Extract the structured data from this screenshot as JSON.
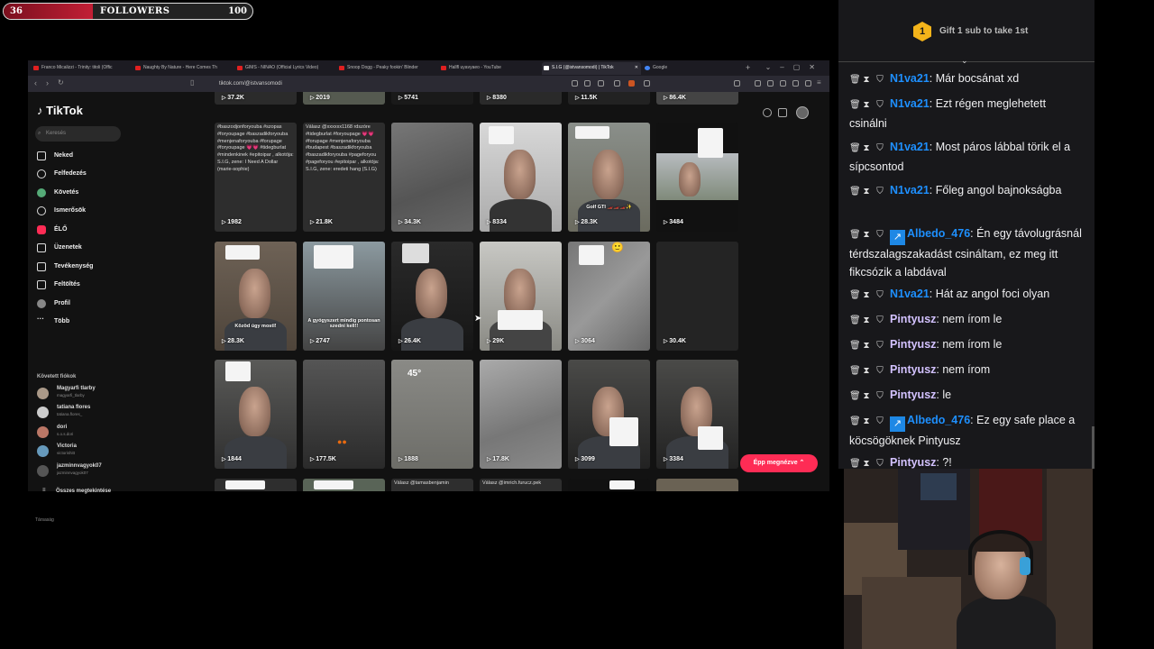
{
  "followers": {
    "current": "36",
    "label": "FOLLOWERS",
    "goal": "100",
    "progress_fraction": 0.36
  },
  "browser": {
    "tabs": [
      {
        "title": "Franco Micalizzi - Trinity: titoli (Offic"
      },
      {
        "title": "Naughty By Nature - Here Comes Th"
      },
      {
        "title": "GIMS - NINAO (Official Lyrics Video)"
      },
      {
        "title": "Snoop Dogg - Peaky fookin' Blinder"
      },
      {
        "title": "Hallfl uyavyaeo - YouTube"
      },
      {
        "title": "S.I.G (@istvansomodi) | TikTok"
      },
      {
        "title": "Google"
      }
    ],
    "url": "tiktok.com/@istvansomodi"
  },
  "tiktok": {
    "logo": "TikTok",
    "search_placeholder": "Keresés",
    "nav": [
      "Neked",
      "Felfedezés",
      "Követés",
      "Ismerősök",
      "ÉLŐ",
      "Üzenetek",
      "Tevékenység",
      "Feltöltés",
      "Profil",
      "Több"
    ],
    "followed_title": "Követett fiókok",
    "followed": [
      {
        "name": "Magyarfi tlarby",
        "handle": "magyarfi_tlarby"
      },
      {
        "name": "tatiana flores",
        "handle": "tatiana.flores_"
      },
      {
        "name": "dori",
        "handle": "s.o.s.dori"
      },
      {
        "name": "Victoria",
        "handle": "victorishitt"
      },
      {
        "name": "jazminnvagyok07",
        "handle": "jazminnvagyok07"
      }
    ],
    "see_all": "Összes megtekintése",
    "company": "Társaság",
    "top_row_counts": [
      "37.2K",
      "2019",
      "5741",
      "8380",
      "11.5K",
      "86.4K"
    ],
    "row1": {
      "caption1": "#baszodjonforyouba #szopas #foryoupage #baszadikforyouba #menjenaforyouba #forupage #foryoupage 💗💗 #tidegburlat #mindenkinek #epitoipar , alkotója: S.I.G, zene: I Need A Dollar (marie-sophie)",
      "caption2": "Válasz @xxxxxx1168 rdszóre #tidegburlat #foryoupage 💗💗 #forupage #menjenaforyouba #budapest #baszadikforyouba #baszadikforyouba #pageforyou #pageforyou #epitoipar , alkotója: S.I.G, zene: eredeti hang (S.I.G)",
      "counts": [
        "1982",
        "21.8K",
        "34.3K",
        "8334",
        "28.3K",
        "3484"
      ],
      "sub5": "Golf GTI 🏎️🏎️🏎️✨"
    },
    "row2": {
      "counts": [
        "28.3K",
        "2747",
        "26.4K",
        "29K",
        "3064",
        "30.4K"
      ],
      "sub1": "Közöd úgy mostl!",
      "sub2": "A gyógyszert mindig pontosan szedni kell!!"
    },
    "row3": {
      "counts": [
        "1844",
        "177.5K",
        "1888",
        "17.8K",
        "3099",
        "3384"
      ],
      "sub3": "45°"
    },
    "bottom_row_captions": [
      "Válasz @tamasbenjamin",
      "Válasz @imrich.furucz.pek"
    ],
    "watching_button": "Épp megnézve ⌃"
  },
  "chat": {
    "gift_badge": "1",
    "gift_text": "Gift 1 sub to take 1st",
    "messages": [
      {
        "user": "N1va21",
        "text": "Már bocsánat xd",
        "color": "#1e90ff"
      },
      {
        "user": "N1va21",
        "text": "Ezt régen meglehetett csinálni",
        "color": "#1e90ff"
      },
      {
        "user": "N1va21",
        "text": "Most páros lábbal törik el a sípcsontod",
        "color": "#1e90ff"
      },
      {
        "user": "N1va21",
        "text": "Főleg angol bajnokságba",
        "color": "#1e90ff"
      },
      {
        "user": "Albedo_476",
        "text": "Én egy távolugrásnál térdszalagszakadást csináltam, ez meg itt fikcsózik a labdával",
        "color": "#1e90ff",
        "vip": true
      },
      {
        "user": "N1va21",
        "text": "Hát az angol foci olyan",
        "color": "#1e90ff"
      },
      {
        "user": "Pintyusz",
        "text": "nem írom le",
        "color": "#d3c2ff"
      },
      {
        "user": "Pintyusz",
        "text": "nem írom le",
        "color": "#d3c2ff"
      },
      {
        "user": "Pintyusz",
        "text": "nem írom",
        "color": "#d3c2ff"
      },
      {
        "user": "Pintyusz",
        "text": "le",
        "color": "#d3c2ff"
      },
      {
        "user": "Albedo_476",
        "text": "Ez egy safe place a köcsögöknek Pintyusz",
        "color": "#1e90ff",
        "vip": true
      },
      {
        "user": "Pintyusz",
        "text": "?!",
        "color": "#d3c2ff"
      }
    ]
  },
  "colors": {
    "tiktok_accent": "#fe2c55",
    "chat_bg": "#18181b",
    "gift_gold": "#f4b41a"
  }
}
